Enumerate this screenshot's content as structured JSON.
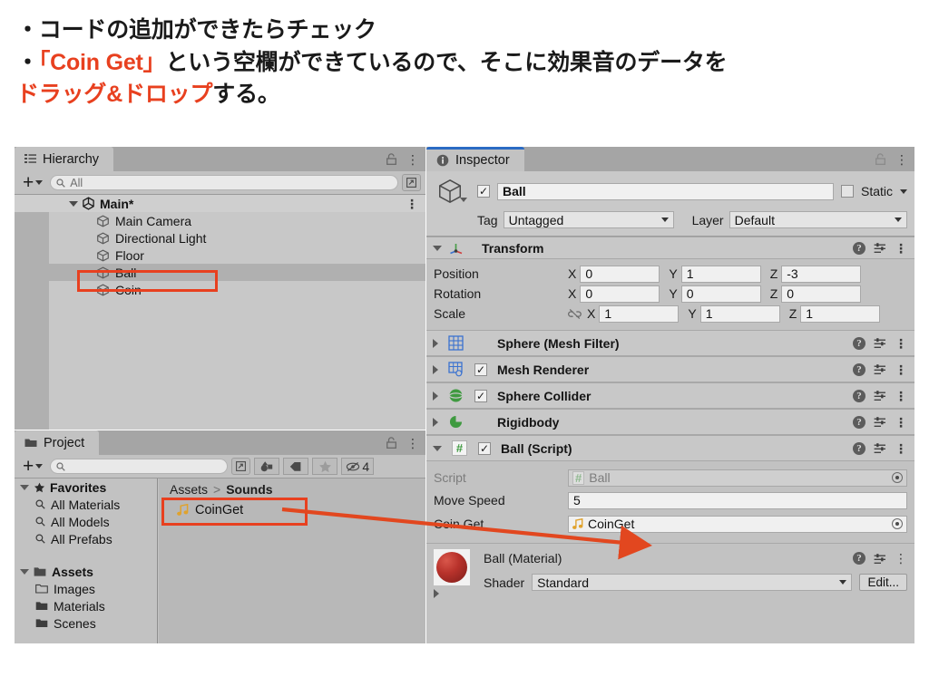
{
  "slide": {
    "line1": "・コードの追加ができたらチェック",
    "line2_bullet": "・",
    "line2_red": "「Coin Get」",
    "line2_rest": "という空欄ができているので、そこに効果音のデータを",
    "line3_red": "ドラッグ&ドロップ",
    "line3_rest": "する。"
  },
  "hierarchy": {
    "tab_label": "Hierarchy",
    "search_placeholder": "All",
    "search_value": "All",
    "items": [
      {
        "label": "Main*",
        "depth": 0,
        "root": true,
        "selected": false
      },
      {
        "label": "Main Camera",
        "depth": 1,
        "root": false,
        "selected": false
      },
      {
        "label": "Directional Light",
        "depth": 1,
        "root": false,
        "selected": false
      },
      {
        "label": "Floor",
        "depth": 1,
        "root": false,
        "selected": false
      },
      {
        "label": "Ball",
        "depth": 1,
        "root": false,
        "selected": true
      },
      {
        "label": "Coin",
        "depth": 1,
        "root": false,
        "selected": false
      }
    ]
  },
  "project": {
    "tab_label": "Project",
    "search_value": "",
    "hidden_count": "4",
    "favorites_label": "Favorites",
    "favorites": [
      "All Materials",
      "All Models",
      "All Prefabs"
    ],
    "assets_label": "Assets",
    "folders": [
      "Images",
      "Materials",
      "Scenes"
    ],
    "breadcrumb_root": "Assets",
    "breadcrumb_sep": ">",
    "breadcrumb_current": "Sounds",
    "asset_item": "CoinGet"
  },
  "inspector": {
    "tab_label": "Inspector",
    "object_name": "Ball",
    "object_enabled": "✓",
    "static_label": "Static",
    "tag_label": "Tag",
    "tag_value": "Untagged",
    "layer_label": "Layer",
    "layer_value": "Default",
    "transform": {
      "title": "Transform",
      "rows": [
        {
          "label": "Position",
          "x": "0",
          "y": "1",
          "z": "-3"
        },
        {
          "label": "Rotation",
          "x": "0",
          "y": "0",
          "z": "0"
        },
        {
          "label": "Scale",
          "x": "1",
          "y": "1",
          "z": "1"
        }
      ],
      "axis_x": "X",
      "axis_y": "Y",
      "axis_z": "Z"
    },
    "components": [
      {
        "title": "Sphere (Mesh Filter)",
        "has_checkbox": false,
        "icon": "mesh-filter-icon"
      },
      {
        "title": "Mesh Renderer",
        "has_checkbox": true,
        "icon": "mesh-renderer-icon"
      },
      {
        "title": "Sphere Collider",
        "has_checkbox": true,
        "icon": "sphere-collider-icon"
      },
      {
        "title": "Rigidbody",
        "has_checkbox": false,
        "icon": "rigidbody-icon"
      }
    ],
    "script_component": {
      "title": "Ball (Script)",
      "script_label": "Script",
      "script_value": "Ball",
      "move_speed_label": "Move Speed",
      "move_speed_value": "5",
      "coin_get_label": "Coin Get",
      "coin_get_value": "CoinGet"
    },
    "material": {
      "title": "Ball (Material)",
      "shader_label": "Shader",
      "shader_value": "Standard",
      "edit_label": "Edit..."
    }
  },
  "colors": {
    "accent_red": "#e8401f",
    "tab_active_blue": "#2b6bc4",
    "panel_bg": "#c2c2c2"
  }
}
